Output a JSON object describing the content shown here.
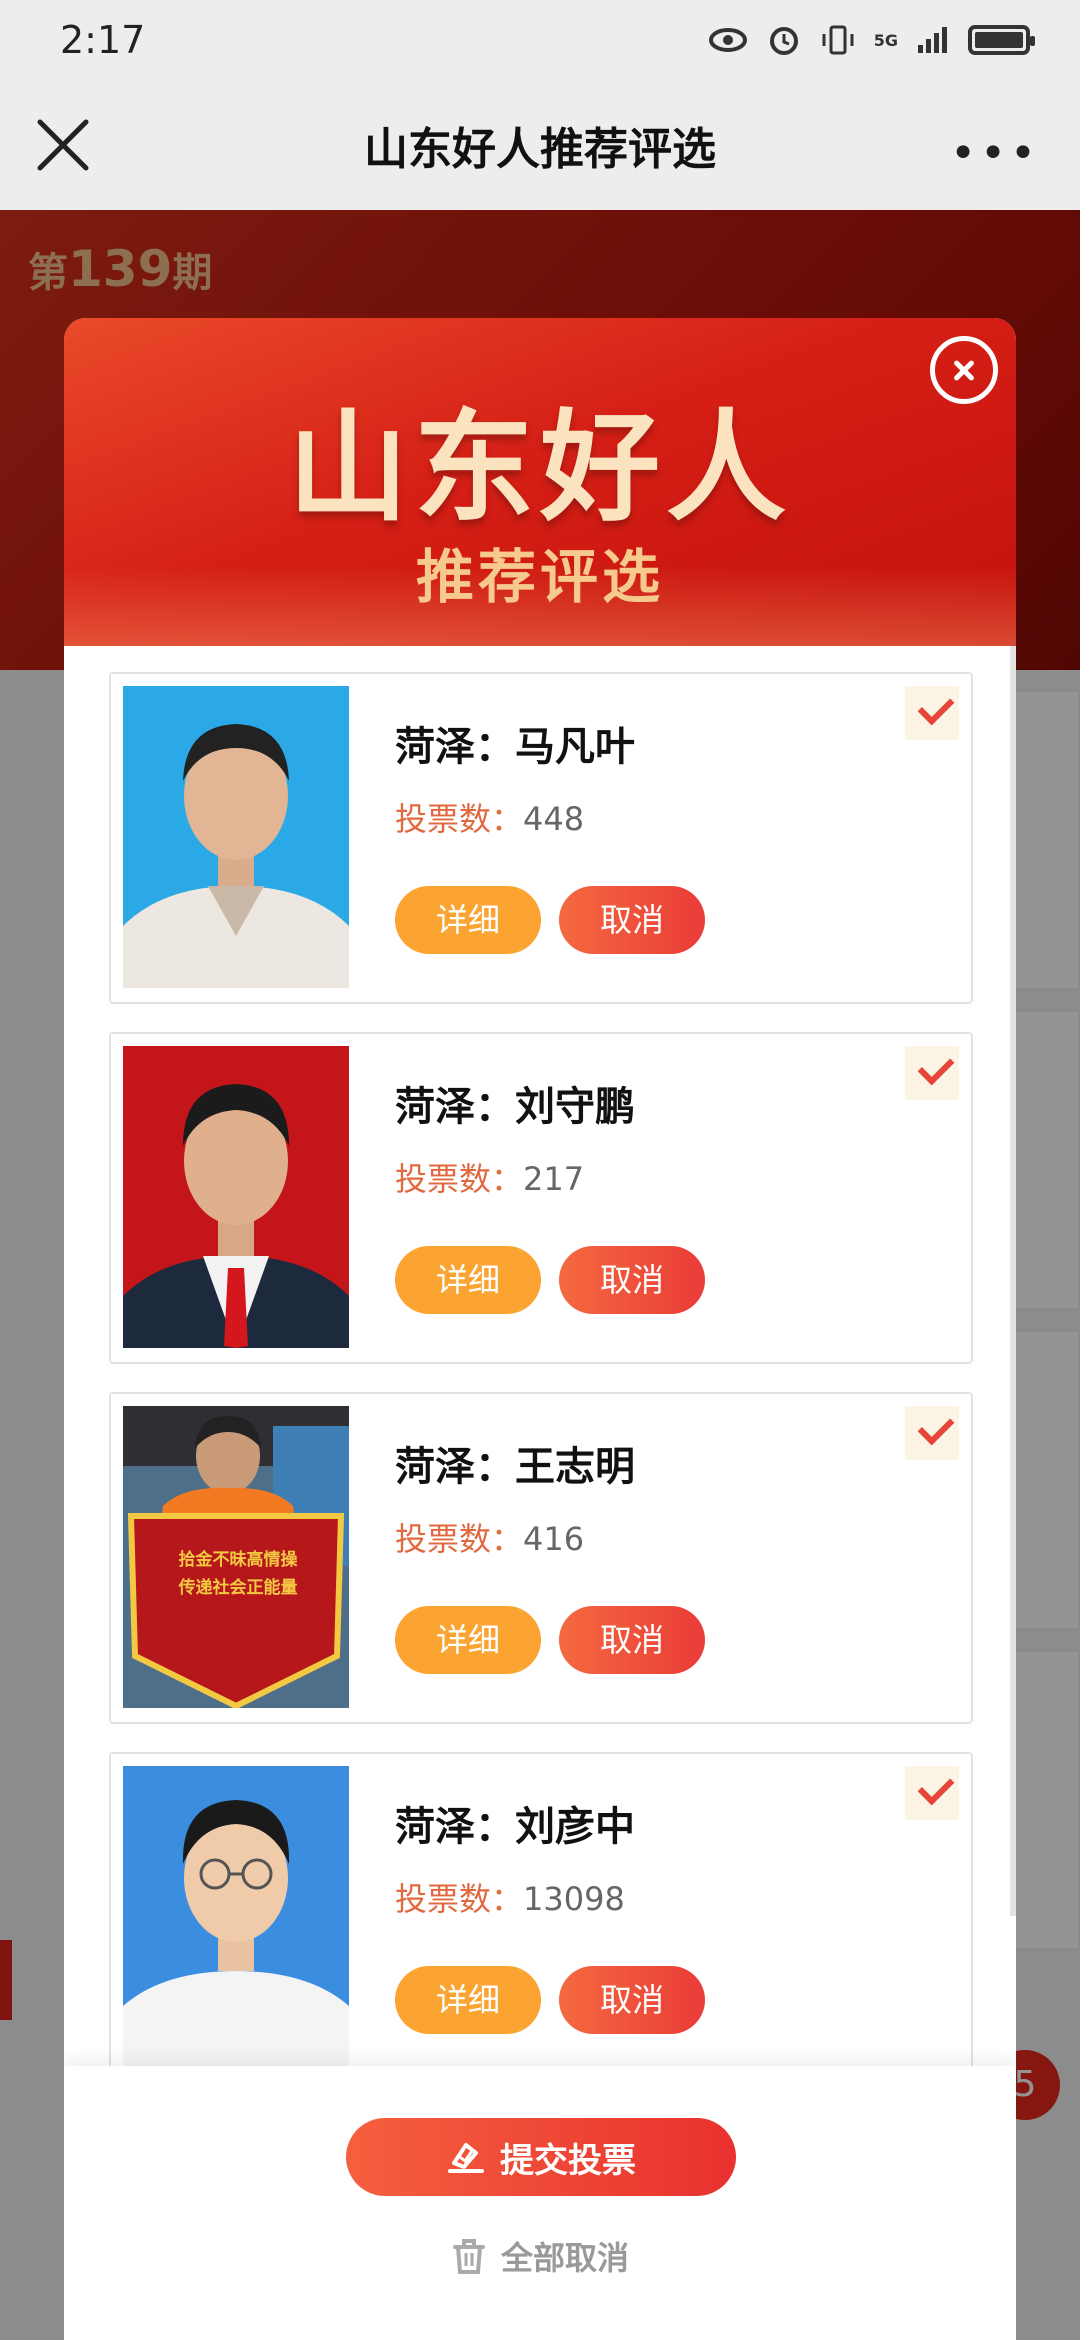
{
  "status_bar": {
    "time": "2:17",
    "network": "5G"
  },
  "nav": {
    "title": "山东好人推荐评选",
    "more": "•••"
  },
  "background": {
    "issue_prefix": "第",
    "issue_number": "139",
    "issue_suffix": "期",
    "badge": "5"
  },
  "modal": {
    "title": "山东好人",
    "subtitle": "推荐评选",
    "candidates": [
      {
        "name": "菏泽：马凡叶",
        "votes_label": "投票数：",
        "votes": "448",
        "detail": "详细",
        "cancel": "取消",
        "selected": true,
        "photo_bg": "#2ba9e6"
      },
      {
        "name": "菏泽：刘守鹏",
        "votes_label": "投票数：",
        "votes": "217",
        "detail": "详细",
        "cancel": "取消",
        "selected": true,
        "photo_bg": "#c4161a"
      },
      {
        "name": "菏泽：王志明",
        "votes_label": "投票数：",
        "votes": "416",
        "detail": "详细",
        "cancel": "取消",
        "selected": true,
        "photo_bg": "#4d6f8a"
      },
      {
        "name": "菏泽：刘彦中",
        "votes_label": "投票数：",
        "votes": "13098",
        "detail": "详细",
        "cancel": "取消",
        "selected": true,
        "photo_bg": "#3b8de0"
      }
    ],
    "banner_text": [
      "拾金不昧高情操",
      "传递社会正能量"
    ],
    "submit": "提交投票",
    "cancel_all": "全部取消"
  }
}
